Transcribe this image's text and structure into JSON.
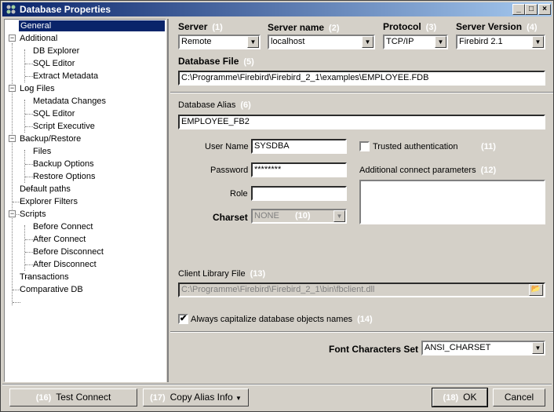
{
  "window": {
    "title": "Database Properties",
    "minimize": "_",
    "maximize": "□",
    "close": "×"
  },
  "tree": [
    {
      "label": "General",
      "selected": true
    },
    {
      "label": "Additional"
    },
    {
      "label": "DB Explorer"
    },
    {
      "label": "SQL Editor"
    },
    {
      "label": "Extract Metadata"
    },
    {
      "label": "Log Files"
    },
    {
      "label": "Metadata Changes"
    },
    {
      "label": "SQL Editor"
    },
    {
      "label": "Script Executive"
    },
    {
      "label": "Backup/Restore"
    },
    {
      "label": "Files"
    },
    {
      "label": "Backup Options"
    },
    {
      "label": "Restore Options"
    },
    {
      "label": "Default paths"
    },
    {
      "label": "Explorer Filters"
    },
    {
      "label": "Scripts"
    },
    {
      "label": "Before Connect"
    },
    {
      "label": "After Connect"
    },
    {
      "label": "Before Disconnect"
    },
    {
      "label": "After Disconnect"
    },
    {
      "label": "Transactions"
    },
    {
      "label": "Comparative DB"
    }
  ],
  "expander": "−",
  "form": {
    "server": {
      "label": "Server",
      "num": "(1)",
      "value": "Remote"
    },
    "server_name": {
      "label": "Server name",
      "num": "(2)",
      "value": "localhost"
    },
    "protocol": {
      "label": "Protocol",
      "num": "(3)",
      "value": "TCP/IP"
    },
    "server_version": {
      "label": "Server Version",
      "num": "(4)",
      "value": "Firebird 2.1"
    },
    "database_file": {
      "label": "Database File",
      "num": "(5)",
      "value": "C:\\Programme\\Firebird\\Firebird_2_1\\examples\\EMPLOYEE.FDB"
    },
    "database_alias": {
      "label": "Database Alias",
      "num": "(6)",
      "value": "EMPLOYEE_FB2"
    },
    "user_name": {
      "label": "User Name",
      "value": "SYSDBA"
    },
    "password": {
      "label": "Password",
      "value": "********"
    },
    "role": {
      "label": "Role",
      "value": ""
    },
    "charset": {
      "label": "Charset",
      "num": "(10)",
      "value": "NONE"
    },
    "trusted": {
      "label": "Trusted authentication",
      "num": "(11)",
      "checked": false
    },
    "additional_params": {
      "label": "Additional connect parameters",
      "num": "(12)"
    },
    "client_library": {
      "label": "Client Library File",
      "num": "(13)",
      "value": "C:\\Programme\\Firebird\\Firebird_2_1\\bin\\fbclient.dll"
    },
    "capitalize": {
      "label": "Always capitalize database objects names",
      "num": "(14)",
      "checked": true,
      "mark": "✔"
    },
    "font_charset": {
      "label": "Font Characters Set",
      "value": "ANSI_CHARSET"
    }
  },
  "buttons": {
    "test_connect": {
      "num": "(16)",
      "label": "Test Connect"
    },
    "copy_alias": {
      "num": "(17)",
      "label": "Copy Alias Info"
    },
    "ok": {
      "num": "(18)",
      "label": "OK"
    },
    "cancel": {
      "label": "Cancel"
    }
  },
  "icons": {
    "drop": "▼",
    "browse": "📂"
  }
}
